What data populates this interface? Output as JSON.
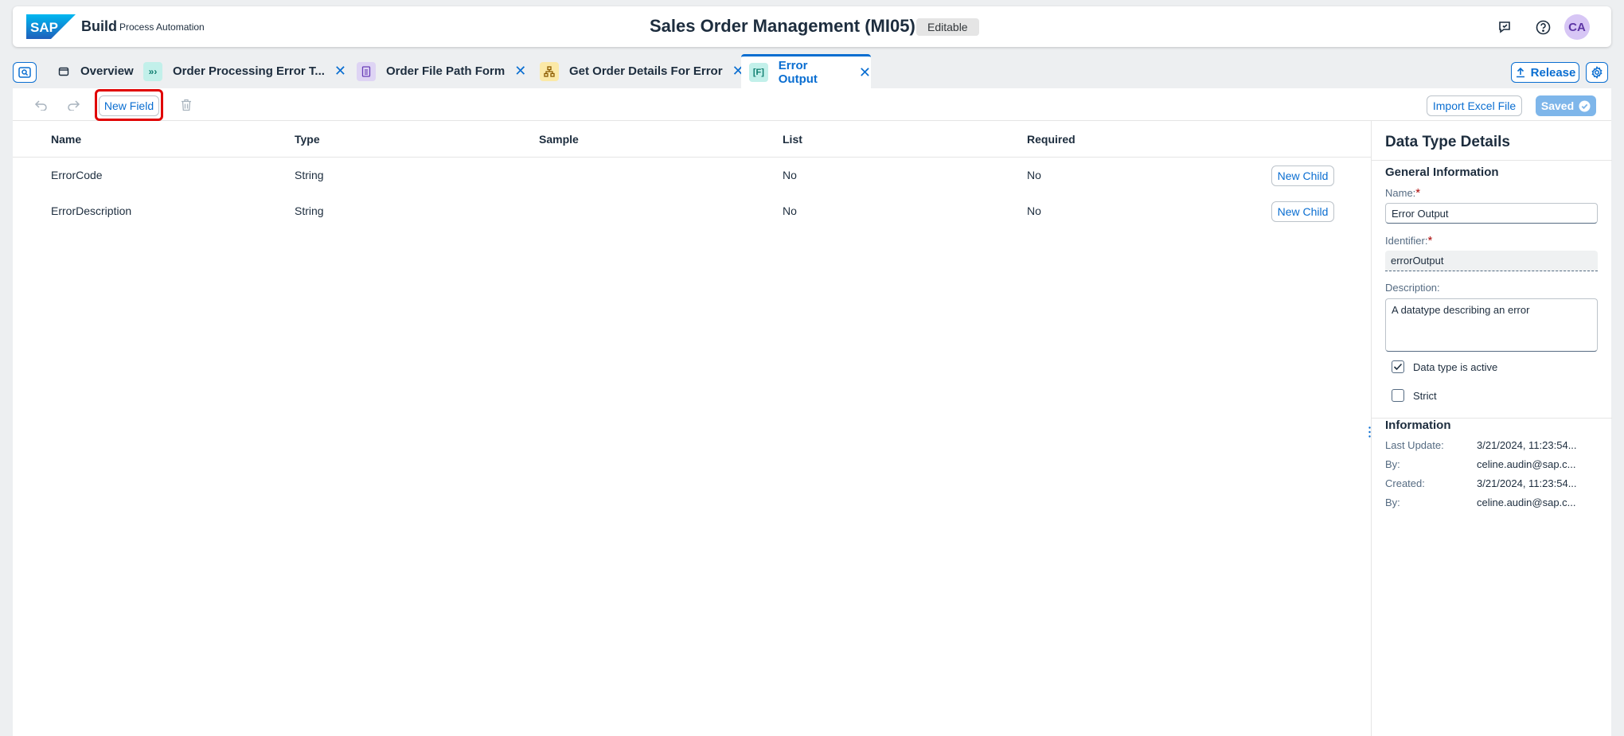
{
  "shell": {
    "logo_text": "SAP",
    "brand": "Build",
    "product": "Process Automation",
    "title": "Sales Order Management (MI05)",
    "badge": "Editable",
    "avatar_initials": "CA",
    "icons": [
      "feedback-icon",
      "help-icon"
    ]
  },
  "tabs": [
    {
      "label": "Overview",
      "icon": "overview-icon",
      "closable": false,
      "active": false
    },
    {
      "label": "Order Processing Error T...",
      "icon": "process-icon",
      "closable": true,
      "active": false
    },
    {
      "label": "Order File Path Form",
      "icon": "form-icon",
      "closable": true,
      "active": false
    },
    {
      "label": "Get Order Details For Error",
      "icon": "decision-icon",
      "closable": true,
      "active": false
    },
    {
      "label": "Error Output",
      "icon": "datatype-icon",
      "closable": true,
      "active": true
    }
  ],
  "tab_actions": {
    "release": "Release"
  },
  "toolbar": {
    "new_field": "New Field",
    "import_excel": "Import Excel File",
    "saved": "Saved"
  },
  "table": {
    "columns": [
      "Name",
      "Type",
      "Sample",
      "List",
      "Required"
    ],
    "rows": [
      {
        "name": "ErrorCode",
        "type": "String",
        "sample": "",
        "list": "No",
        "required": "No",
        "action": "New Child"
      },
      {
        "name": "ErrorDescription",
        "type": "String",
        "sample": "",
        "list": "No",
        "required": "No",
        "action": "New Child"
      }
    ]
  },
  "details": {
    "title": "Data Type Details",
    "general_title": "General Information",
    "name_label": "Name:",
    "name_value": "Error Output",
    "identifier_label": "Identifier:",
    "identifier_value": "errorOutput",
    "description_label": "Description:",
    "description_value": "A datatype describing an error",
    "active_label": "Data type is active",
    "active_checked": true,
    "strict_label": "Strict",
    "strict_checked": false,
    "info_title": "Information",
    "info": [
      {
        "key": "Last Update:",
        "value": "3/21/2024, 11:23:54..."
      },
      {
        "key": "By:",
        "value": "celine.audin@sap.c..."
      },
      {
        "key": "Created:",
        "value": "3/21/2024, 11:23:54..."
      },
      {
        "key": "By:",
        "value": "celine.audin@sap.c..."
      }
    ]
  },
  "colors": {
    "accent": "#0a6ed1",
    "highlight": "#e00000",
    "saved_bg": "#7eb6ea",
    "avatar_bg": "#d7c6f5"
  }
}
